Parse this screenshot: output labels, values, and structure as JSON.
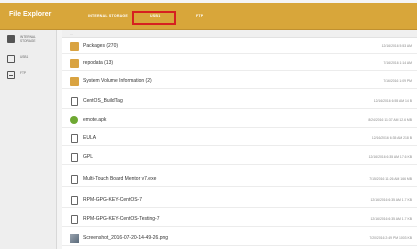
{
  "app": {
    "title": "File Explorer"
  },
  "tabs": [
    {
      "label": "INTERNAL STORAGE"
    },
    {
      "label": "USB1"
    },
    {
      "label": "FTP"
    }
  ],
  "sidebar": {
    "items": [
      {
        "label": "INTERNAL\nSTORAGE",
        "icon": "phone-icon"
      },
      {
        "label": "USB1",
        "icon": "usb-drive-icon"
      },
      {
        "label": "FTP",
        "icon": "ftp-icon"
      }
    ]
  },
  "list": {
    "header": "...",
    "rows": [
      {
        "name": "Packages (270)",
        "meta": "12/16/2016 5:53 AM",
        "type": "folder"
      },
      {
        "name": "repodata (13)",
        "meta": "7/16/2016 1:14 AM",
        "type": "folder"
      },
      {
        "name": "System Volume Information (2)",
        "meta": "7/16/2016 1:09 PM",
        "type": "folder"
      },
      {
        "name": "CentOS_BuildTag",
        "meta": "12/16/2016 6:55 AM   14 B",
        "type": "file"
      },
      {
        "name": "emote.apk",
        "meta": "8/24/2016 11:37 AM   12.6 MB",
        "type": "apk"
      },
      {
        "name": "EULA",
        "meta": "12/16/2016 6:35 AM   218 B",
        "type": "file"
      },
      {
        "name": "GPL",
        "meta": "12/16/2016 6:35 AM   17.6 KB",
        "type": "file"
      },
      {
        "name": "Multi-Touch Board Mentor v7.exe",
        "meta": "7/15/2016 11:26 AM   166 MB",
        "type": "file"
      },
      {
        "name": "RPM-GPG-KEY-CentOS-7",
        "meta": "12/16/2016 6:35 AM   1.7 KB",
        "type": "file"
      },
      {
        "name": "RPM-GPG-KEY-CentOS-Testing-7",
        "meta": "12/16/2016 6:35 AM   1.7 KB",
        "type": "file"
      },
      {
        "name": "Screenshot_2016-07-20-14-49-26.png",
        "meta": "7/20/2016 2:49 PM   1003 KB",
        "type": "image"
      }
    ]
  },
  "colors": {
    "accent": "#d8a63a",
    "selection_outline": "#d62020"
  }
}
